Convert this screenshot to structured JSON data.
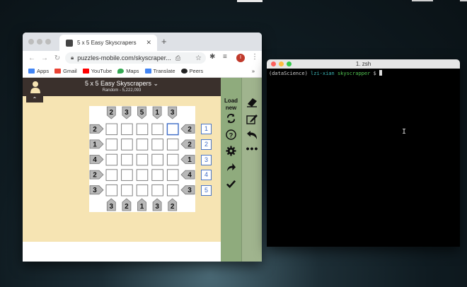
{
  "browser": {
    "tab_title": "5 x 5 Easy Skyscrapers",
    "address": "puzzles-mobile.com/skyscraper...",
    "profile_initial": "I",
    "bookmarks": [
      {
        "label": "Apps",
        "color": "#4285f4"
      },
      {
        "label": "Gmail",
        "color": "#ea4335"
      },
      {
        "label": "YouTube",
        "color": "#ff0000"
      },
      {
        "label": "Maps",
        "color": "#34a853"
      },
      {
        "label": "Translate",
        "color": "#4285f4"
      },
      {
        "label": "Peers",
        "color": "#222222"
      }
    ],
    "overflow": "»"
  },
  "game": {
    "title": "5 x 5 Easy Skyscrapers ⌄",
    "subtitle": "Random - 5,222,093",
    "top_clues": [
      "2",
      "3",
      "5",
      "1",
      "3"
    ],
    "bottom_clues": [
      "3",
      "2",
      "1",
      "3",
      "2"
    ],
    "left_clues": [
      "2",
      "1",
      "4",
      "2",
      "3"
    ],
    "right_clues": [
      "2",
      "2",
      "1",
      "4",
      "3"
    ],
    "row_numbers": [
      "1",
      "2",
      "3",
      "4",
      "5"
    ]
  },
  "sidebar": {
    "load_new": "Load new"
  },
  "terminal": {
    "title": "1. zsh",
    "env": "(dataScience)",
    "user": "lzi-xian",
    "dir": "skyscrapper",
    "prompt": "$"
  },
  "colors": {
    "header": "#3a302c",
    "board_bg": "#f6e4b3",
    "sidebar": "#8fab7d",
    "env": "#cfcfcf",
    "user": "#3db8b8",
    "dir": "#52c452",
    "blue": "#3d6bc6"
  }
}
